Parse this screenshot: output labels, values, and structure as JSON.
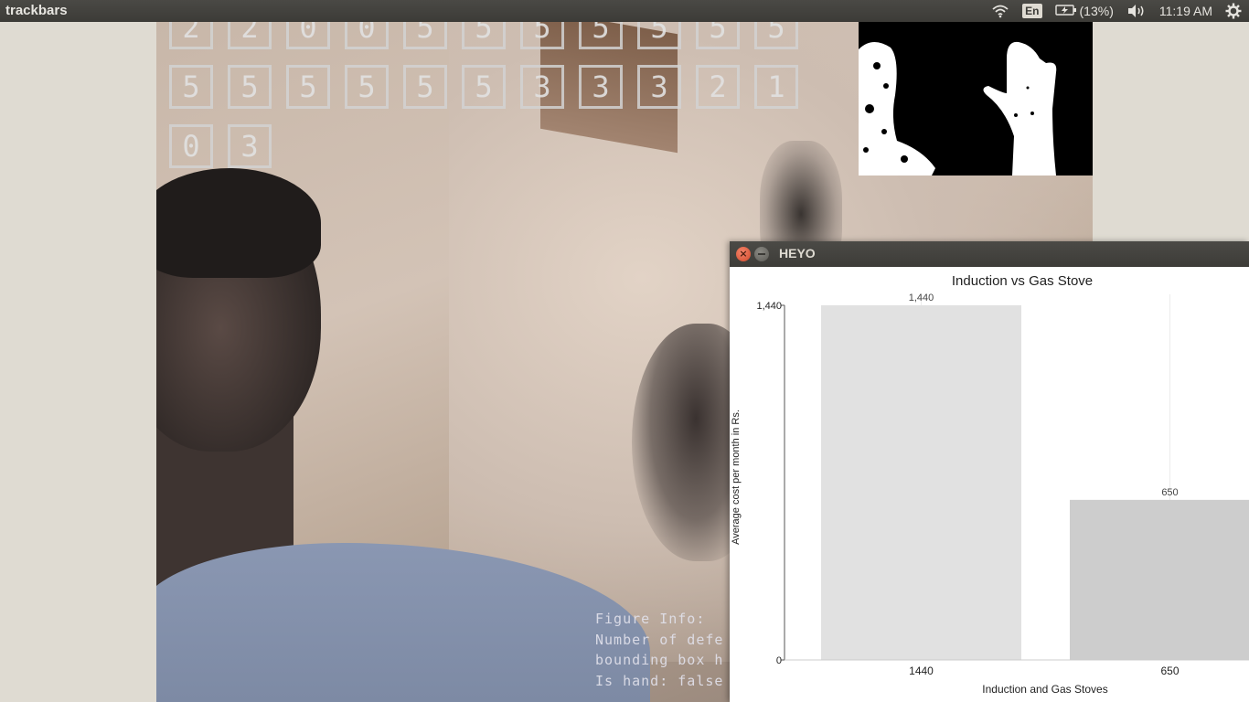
{
  "topbar": {
    "app_title": "trackbars",
    "language": "En",
    "battery": "(13%)",
    "time": "11:19 AM"
  },
  "camera": {
    "digit_rows": [
      [
        "2",
        "2",
        "0",
        "0",
        "5",
        "5",
        "5",
        "5",
        "5",
        "5",
        "5"
      ],
      [
        "5",
        "5",
        "5",
        "5",
        "5",
        "5",
        "3",
        "3",
        "3",
        "2",
        "1"
      ],
      [
        "0",
        "3"
      ]
    ],
    "figure_info": {
      "line1": "Figure Info:",
      "line2": "Number of defe",
      "line3": "bounding box h",
      "line4": "Is hand: false"
    }
  },
  "window": {
    "title": "HEYO",
    "close_symbol": "×"
  },
  "chart_data": {
    "type": "bar",
    "title": "Induction vs Gas Stove",
    "xlabel": "Induction and Gas Stoves",
    "ylabel": "Average cost per month in Rs.",
    "categories": [
      "1440",
      "650"
    ],
    "values": [
      1440,
      650
    ],
    "value_labels": [
      "1,440",
      "650"
    ],
    "y_ticks": [
      "0",
      "1,440"
    ],
    "ylim": [
      0,
      1440
    ],
    "bar_colors": [
      "#e1e1e1",
      "#cdcdcd"
    ],
    "grid": true
  }
}
